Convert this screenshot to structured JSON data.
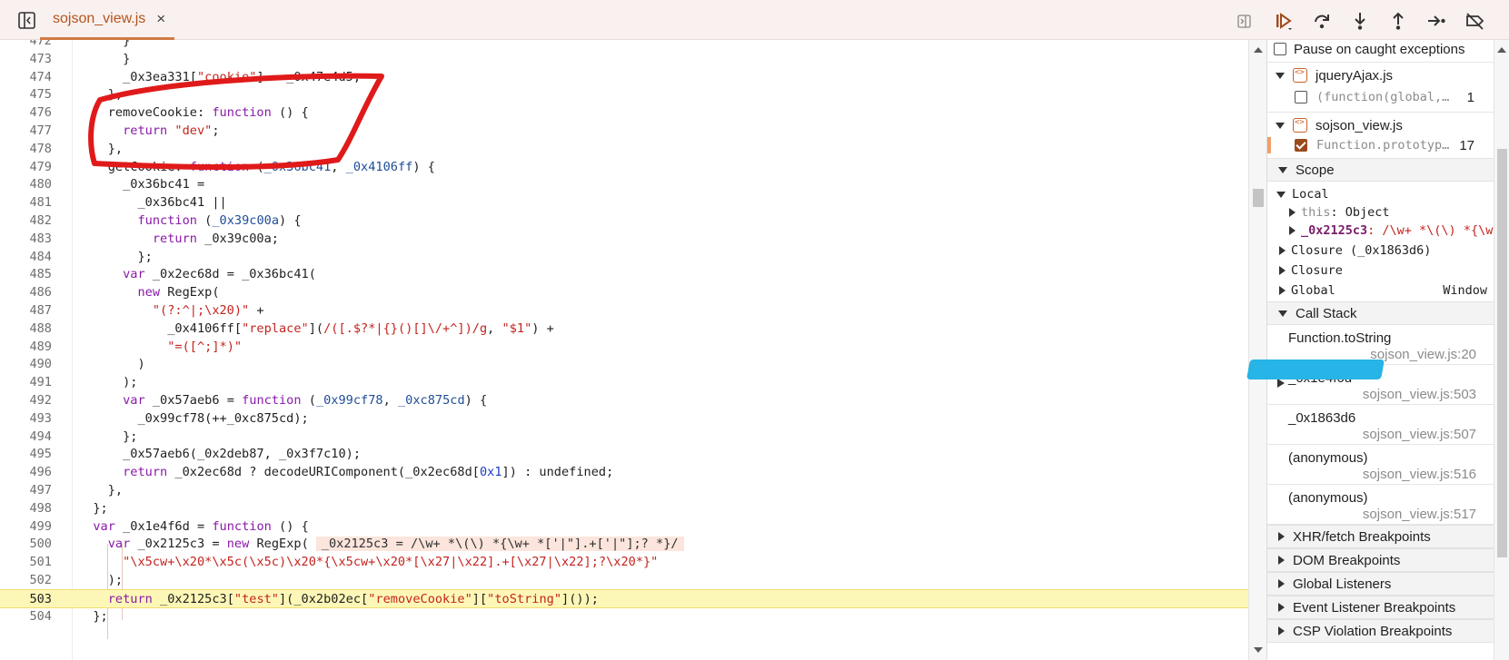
{
  "tab": {
    "label": "sojson_view.js",
    "close": "×"
  },
  "toolbar": {
    "icons": [
      "sidebar-toggle-icon",
      "close-icon",
      "right-panel-toggle-icon",
      "resume-icon",
      "step-over-icon",
      "step-into-icon",
      "step-out-icon",
      "step-icon",
      "deactivate-breakpoints-icon"
    ]
  },
  "editor": {
    "lines": [
      {
        "n": "472",
        "code": "      }"
      },
      {
        "n": "473",
        "code": "      }"
      },
      {
        "n": "474",
        "code": "      _0x3ea331[\"cookie\"] = _0x47e4d5;"
      },
      {
        "n": "475",
        "code": "    },"
      },
      {
        "n": "476",
        "code": "    removeCookie: function () {"
      },
      {
        "n": "477",
        "code": "      return \"dev\";"
      },
      {
        "n": "478",
        "code": "    },"
      },
      {
        "n": "479",
        "code": "    getCookie: function (_0x36bc41, _0x4106ff) {"
      },
      {
        "n": "480",
        "code": "      _0x36bc41 ="
      },
      {
        "n": "481",
        "code": "        _0x36bc41 ||"
      },
      {
        "n": "482",
        "code": "        function (_0x39c00a) {"
      },
      {
        "n": "483",
        "code": "          return _0x39c00a;"
      },
      {
        "n": "484",
        "code": "        };"
      },
      {
        "n": "485",
        "code": "      var _0x2ec68d = _0x36bc41("
      },
      {
        "n": "486",
        "code": "        new RegExp("
      },
      {
        "n": "487",
        "code": "          \"(?:^|;\\x20)\" +"
      },
      {
        "n": "488",
        "code": "            _0x4106ff[\"replace\"](/([.$?*|{}()[]\\/+^])/g, \"$1\") +"
      },
      {
        "n": "489",
        "code": "            \"=([^;]*)\""
      },
      {
        "n": "490",
        "code": "        )"
      },
      {
        "n": "491",
        "code": "      );"
      },
      {
        "n": "492",
        "code": "      var _0x57aeb6 = function (_0x99cf78, _0xc875cd) {"
      },
      {
        "n": "493",
        "code": "        _0x99cf78(++_0xc875cd);"
      },
      {
        "n": "494",
        "code": "      };"
      },
      {
        "n": "495",
        "code": "      _0x57aeb6(_0x2deb87, _0x3f7c10);"
      },
      {
        "n": "496",
        "code": "      return _0x2ec68d ? decodeURIComponent(_0x2ec68d[0x1]) : undefined;"
      },
      {
        "n": "497",
        "code": "    },"
      },
      {
        "n": "498",
        "code": "  };"
      },
      {
        "n": "499",
        "code": "  var _0x1e4f6d = function () {"
      },
      {
        "n": "500",
        "code": "    var _0x2125c3 = new RegExp("
      },
      {
        "n": "501",
        "code": "      \"\\x5cw+\\x20*\\x5c(\\x5c)\\x20*{\\x5cw+\\x20*[\\x27|\\x22].+[\\x27|\\x22];?\\x20*}\""
      },
      {
        "n": "502",
        "code": "    );"
      },
      {
        "n": "503",
        "code": "    return _0x2125c3[\"test\"](_0x2b02ec[\"removeCookie\"][\"toString\"]());"
      },
      {
        "n": "504",
        "code": "  };"
      }
    ],
    "inline_hint": "_0x2125c3 = /\\w+ *\\(\\) *{\\w+ *['|\"].+['|\"];? *}/"
  },
  "panel": {
    "pause_caught": "Pause on caught exceptions",
    "breakpoint_files": [
      {
        "file": "jqueryAjax.js",
        "entry": "(function(global,…",
        "line": "1",
        "checked": false
      },
      {
        "file": "sojson_view.js",
        "entry": "Function.prototyp…",
        "line": "17",
        "checked": true
      }
    ],
    "scope": {
      "title": "Scope",
      "local": "Local",
      "this_key": "this",
      "this_val": ": Object",
      "var_key": "_0x2125c3",
      "var_val": ": /\\w+ *\\(\\) *{\\w",
      "closure1": "Closure (_0x1863d6)",
      "closure2": "Closure",
      "global": "Global",
      "global_val": "Window"
    },
    "call_stack": {
      "title": "Call Stack",
      "frames": [
        {
          "fn": "Function.toString",
          "loc": "sojson_view.js:20",
          "current": false
        },
        {
          "fn": "_0x1e4f6d",
          "loc": "sojson_view.js:503",
          "current": true
        },
        {
          "fn": "_0x1863d6",
          "loc": "sojson_view.js:507",
          "current": false
        },
        {
          "fn": "(anonymous)",
          "loc": "sojson_view.js:516",
          "current": false
        },
        {
          "fn": "(anonymous)",
          "loc": "sojson_view.js:517",
          "current": false
        }
      ]
    },
    "sections": [
      "XHR/fetch Breakpoints",
      "DOM Breakpoints",
      "Global Listeners",
      "Event Listener Breakpoints",
      "CSP Violation Breakpoints"
    ]
  },
  "colors": {
    "accent": "#b5531c",
    "annotation_red": "#e01a1a",
    "annotation_blue": "#27b4e6",
    "active_line": "#fdf7b7"
  }
}
